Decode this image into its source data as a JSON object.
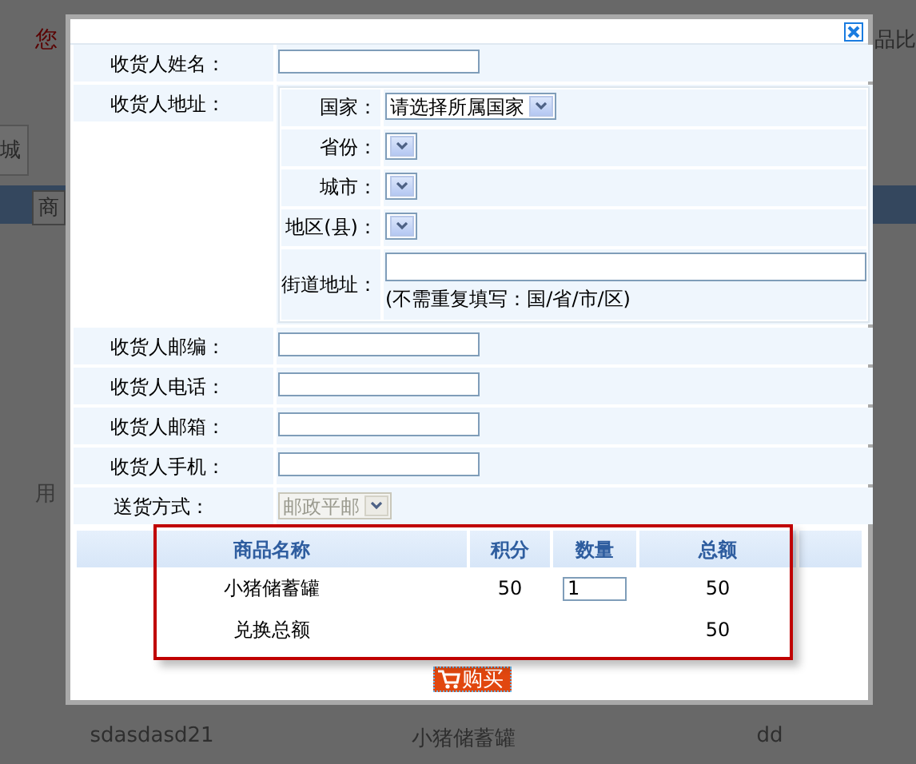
{
  "background": {
    "greeting": "您",
    "compare_link": "品比",
    "tab": "城",
    "category_select": "商",
    "user_label": "用",
    "product_names": [
      "sdasdasd21",
      "小猪储蓄罐",
      "dd"
    ]
  },
  "dialog": {
    "form": {
      "name": {
        "label": "收货人姓名："
      },
      "address": {
        "label": "收货人地址：",
        "country": {
          "label": "国家：",
          "value": "请选择所属国家"
        },
        "province": {
          "label": "省份："
        },
        "city": {
          "label": "城市："
        },
        "district": {
          "label": "地区(县)："
        },
        "street": {
          "label": "街道地址：",
          "hint": "(不需重复填写：国/省/市/区)"
        }
      },
      "postcode": {
        "label": "收货人邮编："
      },
      "phone": {
        "label": "收货人电话："
      },
      "email": {
        "label": "收货人邮箱："
      },
      "mobile": {
        "label": "收货人手机："
      },
      "shipping": {
        "label": "送货方式：",
        "value": "邮政平邮",
        "disabled": true
      }
    },
    "table": {
      "columns": [
        "商品名称",
        "积分",
        "数量",
        "总额"
      ],
      "rows": [
        {
          "name": "小猪储蓄罐",
          "points": "50",
          "quantity": "1",
          "total": "50"
        }
      ],
      "summary": {
        "label": "兑换总额",
        "total": "50"
      }
    },
    "buy_button": "购买"
  }
}
